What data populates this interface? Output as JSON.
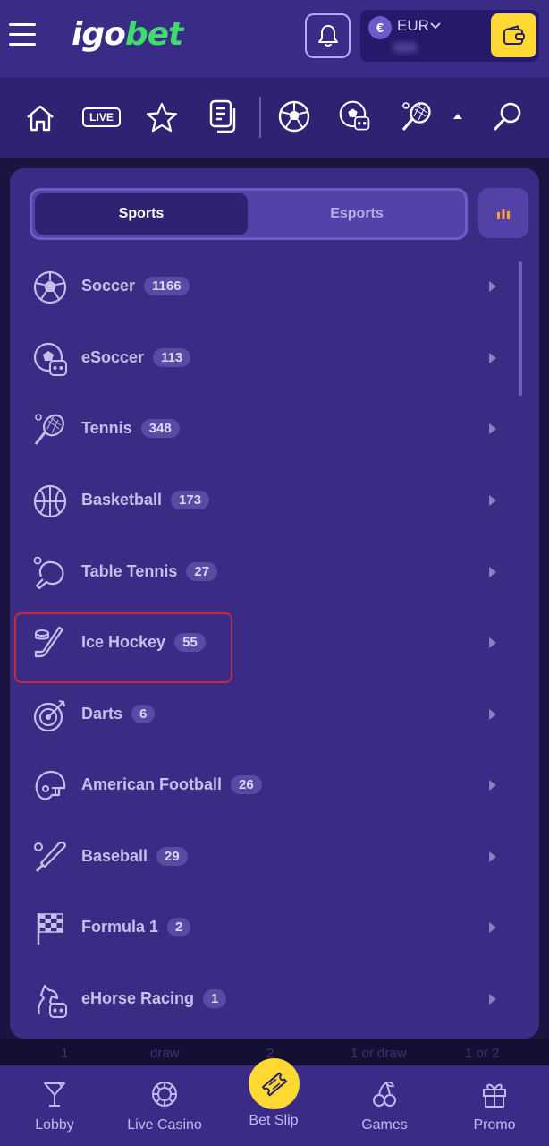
{
  "header": {
    "logo_part1": "igo",
    "logo_part2": "bet",
    "currency_symbol": "€",
    "currency": "EUR"
  },
  "sport_nav": {
    "live_label": "LIVE"
  },
  "panel": {
    "tabs": [
      {
        "label": "Sports",
        "active": true
      },
      {
        "label": "Esports",
        "active": false
      }
    ],
    "sports": [
      {
        "name": "Soccer",
        "count": "1166",
        "icon": "soccer-ball-icon"
      },
      {
        "name": "eSoccer",
        "count": "113",
        "icon": "esoccer-icon"
      },
      {
        "name": "Tennis",
        "count": "348",
        "icon": "tennis-racket-icon"
      },
      {
        "name": "Basketball",
        "count": "173",
        "icon": "basketball-icon"
      },
      {
        "name": "Table Tennis",
        "count": "27",
        "icon": "table-tennis-icon"
      },
      {
        "name": "Ice Hockey",
        "count": "55",
        "icon": "hockey-stick-icon"
      },
      {
        "name": "Darts",
        "count": "6",
        "icon": "dartboard-icon"
      },
      {
        "name": "American Football",
        "count": "26",
        "icon": "football-helmet-icon"
      },
      {
        "name": "Baseball",
        "count": "29",
        "icon": "baseball-bat-icon"
      },
      {
        "name": "Formula 1",
        "count": "2",
        "icon": "checkered-flag-icon"
      },
      {
        "name": "eHorse Racing",
        "count": "1",
        "icon": "ehorse-icon"
      }
    ],
    "highlighted": "Ice Hockey"
  },
  "peek_row": [
    "1",
    "draw",
    "2",
    "1 or draw",
    "1 or 2"
  ],
  "bottom_nav": [
    {
      "label": "Lobby",
      "icon": "cocktail-icon"
    },
    {
      "label": "Live Casino",
      "icon": "chip-icon"
    },
    {
      "label": "Bet Slip",
      "icon": "ticket-icon"
    },
    {
      "label": "Games",
      "icon": "cherries-icon"
    },
    {
      "label": "Promo",
      "icon": "gift-icon"
    }
  ],
  "colors": {
    "header_bg": "#3a2b86",
    "panel_bg": "#3b2b85",
    "accent_yellow": "#ffd932",
    "logo_green": "#3ddc6b",
    "highlight_red": "#c22f3a"
  }
}
